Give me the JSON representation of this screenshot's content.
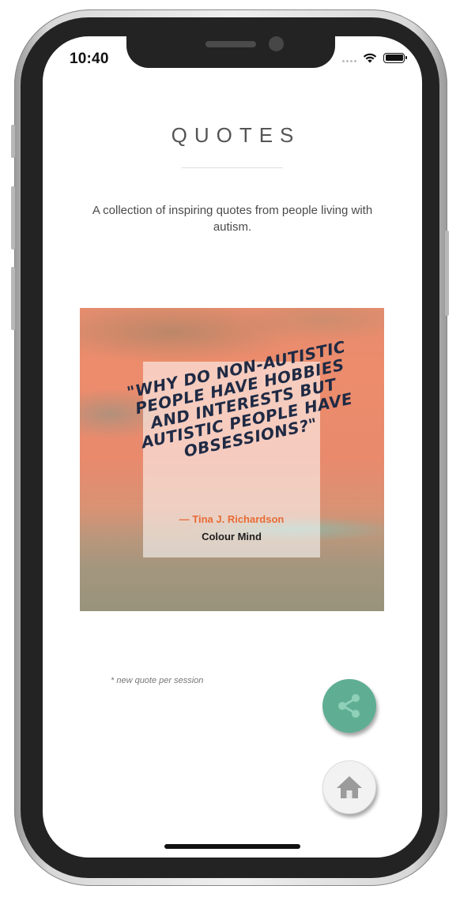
{
  "status_bar": {
    "time": "10:40"
  },
  "header": {
    "title": "QUOTES",
    "intro": "A collection of inspiring quotes from people living with autism."
  },
  "quote": {
    "text": "\"WHY DO NON-AUTISTIC PEOPLE HAVE HOBBIES AND INTERESTS BUT AUTISTIC PEOPLE HAVE OBSESSIONS?\"",
    "author": "— Tina J. Richardson",
    "brand": "Colour Mind"
  },
  "footnote": "* new quote per session",
  "buttons": {
    "share_icon": "share-icon",
    "home_icon": "home-icon"
  },
  "colors": {
    "accent": "#5fae94",
    "author": "#e86b36",
    "quote_text": "#1f2a44"
  }
}
